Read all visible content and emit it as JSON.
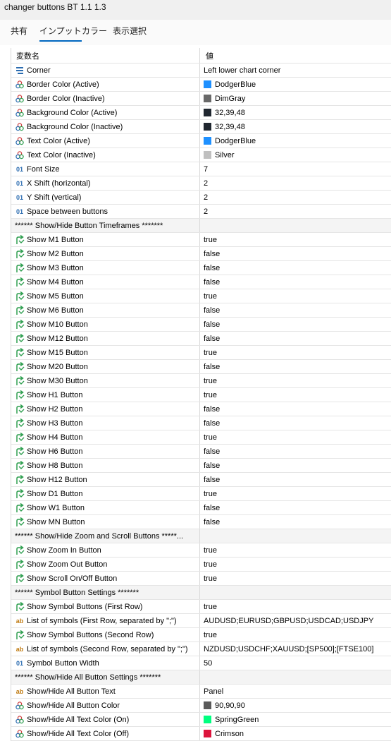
{
  "window": {
    "title": "changer buttons BT 1.1 1.3"
  },
  "tabs": [
    "共有",
    "インプット",
    "カラー",
    "表示選択"
  ],
  "active_tab": 1,
  "table": {
    "headers": {
      "name": "変数名",
      "value": "値"
    },
    "rows": [
      {
        "kind": "enum",
        "name": "Corner",
        "value": "Left lower chart corner"
      },
      {
        "kind": "color",
        "name": "Border Color (Active)",
        "value": "DodgerBlue",
        "swatch": "#1e90ff"
      },
      {
        "kind": "color",
        "name": "Border Color (Inactive)",
        "value": "DimGray",
        "swatch": "#696969"
      },
      {
        "kind": "color",
        "name": "Background Color (Active)",
        "value": "32,39,48",
        "swatch": "#202730"
      },
      {
        "kind": "color",
        "name": "Background Color (Inactive)",
        "value": "32,39,48",
        "swatch": "#202730"
      },
      {
        "kind": "color",
        "name": "Text Color (Active)",
        "value": "DodgerBlue",
        "swatch": "#1e90ff"
      },
      {
        "kind": "color",
        "name": "Text Color (Inactive)",
        "value": "Silver",
        "swatch": "#c0c0c0"
      },
      {
        "kind": "int",
        "name": "Font Size",
        "value": "7"
      },
      {
        "kind": "int",
        "name": "X Shift (horizontal)",
        "value": "2"
      },
      {
        "kind": "int",
        "name": "Y Shift (vertical)",
        "value": "2"
      },
      {
        "kind": "int",
        "name": "Space between buttons",
        "value": "2"
      },
      {
        "kind": "sep",
        "name": "****** Show/Hide Button Timeframes *******",
        "value": ""
      },
      {
        "kind": "bool",
        "name": "Show M1 Button",
        "value": "true"
      },
      {
        "kind": "bool",
        "name": "Show M2 Button",
        "value": "false"
      },
      {
        "kind": "bool",
        "name": "Show M3 Button",
        "value": "false"
      },
      {
        "kind": "bool",
        "name": "Show M4 Button",
        "value": "false"
      },
      {
        "kind": "bool",
        "name": "Show M5 Button",
        "value": "true"
      },
      {
        "kind": "bool",
        "name": "Show M6 Button",
        "value": "false"
      },
      {
        "kind": "bool",
        "name": "Show M10 Button",
        "value": "false"
      },
      {
        "kind": "bool",
        "name": "Show M12 Button",
        "value": "false"
      },
      {
        "kind": "bool",
        "name": "Show M15 Button",
        "value": "true"
      },
      {
        "kind": "bool",
        "name": "Show M20 Button",
        "value": "false"
      },
      {
        "kind": "bool",
        "name": "Show M30 Button",
        "value": "true"
      },
      {
        "kind": "bool",
        "name": "Show H1 Button",
        "value": "true"
      },
      {
        "kind": "bool",
        "name": "Show H2 Button",
        "value": "false"
      },
      {
        "kind": "bool",
        "name": "Show H3 Button",
        "value": "false"
      },
      {
        "kind": "bool",
        "name": "Show H4 Button",
        "value": "true"
      },
      {
        "kind": "bool",
        "name": "Show H6 Button",
        "value": "false"
      },
      {
        "kind": "bool",
        "name": "Show H8 Button",
        "value": "false"
      },
      {
        "kind": "bool",
        "name": "Show H12 Button",
        "value": "false"
      },
      {
        "kind": "bool",
        "name": "Show D1 Button",
        "value": "true"
      },
      {
        "kind": "bool",
        "name": "Show W1 Button",
        "value": "false"
      },
      {
        "kind": "bool",
        "name": "Show MN Button",
        "value": "false"
      },
      {
        "kind": "sep",
        "name": "****** Show/Hide Zoom and Scroll Buttons *****...",
        "value": ""
      },
      {
        "kind": "bool",
        "name": "Show Zoom In Button",
        "value": "true"
      },
      {
        "kind": "bool",
        "name": "Show Zoom Out Button",
        "value": "true"
      },
      {
        "kind": "bool",
        "name": "Show Scroll On/Off Button",
        "value": "true"
      },
      {
        "kind": "sep",
        "name": "****** Symbol Button Settings *******",
        "value": ""
      },
      {
        "kind": "bool",
        "name": "Show Symbol Buttons (First Row)",
        "value": "true"
      },
      {
        "kind": "string",
        "name": "List of symbols (First Row, separated by \";\")",
        "value": "AUDUSD;EURUSD;GBPUSD;USDCAD;USDJPY"
      },
      {
        "kind": "bool",
        "name": "Show Symbol Buttons (Second Row)",
        "value": "true"
      },
      {
        "kind": "string",
        "name": "List of symbols (Second Row, separated by \";\")",
        "value": "NZDUSD;USDCHF;XAUUSD;[SP500];[FTSE100]"
      },
      {
        "kind": "int",
        "name": "Symbol Button Width",
        "value": "50"
      },
      {
        "kind": "sep",
        "name": "****** Show/Hide All Button Settings *******",
        "value": ""
      },
      {
        "kind": "string",
        "name": "Show/Hide All Button Text",
        "value": "Panel"
      },
      {
        "kind": "color",
        "name": "Show/Hide All Button Color",
        "value": "90,90,90",
        "swatch": "#5a5a5a"
      },
      {
        "kind": "color",
        "name": "Show/Hide All Text Color (On)",
        "value": "SpringGreen",
        "swatch": "#00ff7f"
      },
      {
        "kind": "color",
        "name": "Show/Hide All Text Color (Off)",
        "value": "Crimson",
        "swatch": "#dc143c"
      }
    ]
  },
  "icons": {
    "enum": "list-icon",
    "color": "color-palette-icon",
    "int": "integer-01-icon",
    "bool": "boolean-arrow-icon",
    "string": "string-ab-icon"
  },
  "icon_text": {
    "int": "01",
    "string": "ab"
  }
}
